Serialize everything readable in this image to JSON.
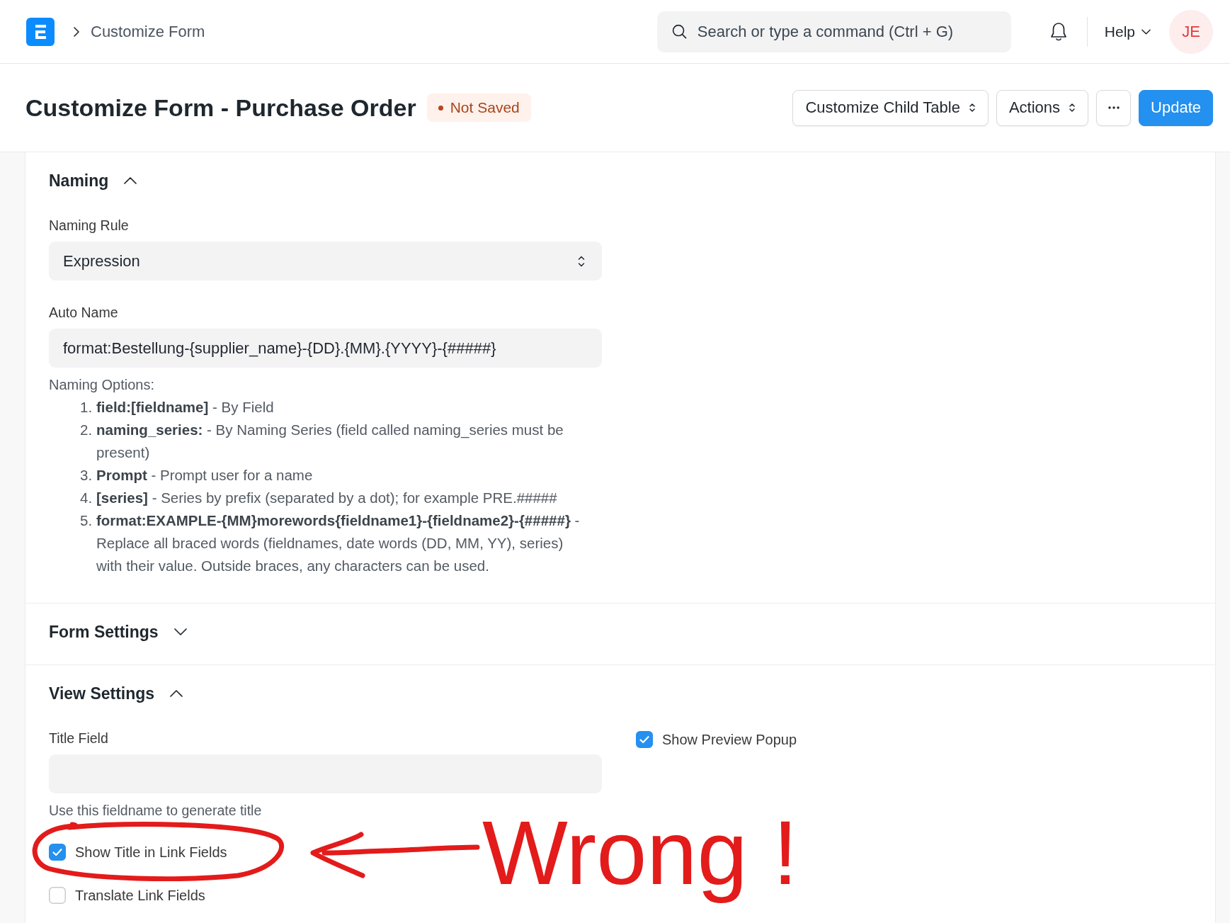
{
  "navbar": {
    "breadcrumbs": [
      "Customize Form"
    ],
    "search": {
      "placeholder": "Search or type a command (Ctrl + G)"
    },
    "help": "Help",
    "avatar": "JE"
  },
  "page_header": {
    "title": "Customize Form - Purchase Order",
    "status": "Not Saved",
    "buttons": [
      {
        "kind": "dropdown",
        "label": "Customize Child Table"
      },
      {
        "kind": "dropdown",
        "label": "Actions"
      },
      {
        "kind": "more"
      },
      {
        "kind": "primary",
        "label": "Update"
      }
    ]
  },
  "sections": [
    {
      "title": "Naming",
      "expanded": true,
      "columns": [
        [
          {
            "kind": "select",
            "label": "Naming Rule",
            "value": "Expression"
          },
          {
            "kind": "text",
            "label": "Auto Name",
            "value": "format:Bestellung-{supplier_name}-{DD}.{MM}.{YYYY}-{#####}",
            "help": {
              "intro": "Naming Options:",
              "items": [
                {
                  "number": "1.",
                  "text": "**field:[fieldname]** - By Field"
                },
                {
                  "number": "2.",
                  "text": "**naming_series:** - By Naming Series (field called naming_series must be present)"
                },
                {
                  "number": "3.",
                  "text": "**Prompt** - Prompt user for a name"
                },
                {
                  "number": "4.",
                  "text": "**[series]** - Series by prefix (separated by a dot); for example PRE.#####"
                },
                {
                  "number": "5.",
                  "text": "**format:EXAMPLE-{MM}morewords{fieldname1}-{fieldname2}-{#####}** - Replace all braced words (fieldnames, date words (DD, MM, YY), series) with their value. Outside braces, any characters can be used."
                }
              ]
            }
          }
        ]
      ]
    },
    {
      "title": "Form Settings",
      "expanded": false
    },
    {
      "title": "View Settings",
      "expanded": true,
      "columns": [
        [
          {
            "kind": "text",
            "label": "Title Field",
            "description": "Use this fieldname to generate title"
          },
          {
            "kind": "check",
            "label": "Show Title in Link Fields",
            "checked": true
          },
          {
            "kind": "check",
            "label": "Translate Link Fields",
            "checked": false
          }
        ],
        [
          {
            "kind": "check",
            "label": "Show Preview Popup",
            "checked": true
          }
        ]
      ]
    }
  ],
  "annotation": {
    "text": "Wrong !"
  }
}
